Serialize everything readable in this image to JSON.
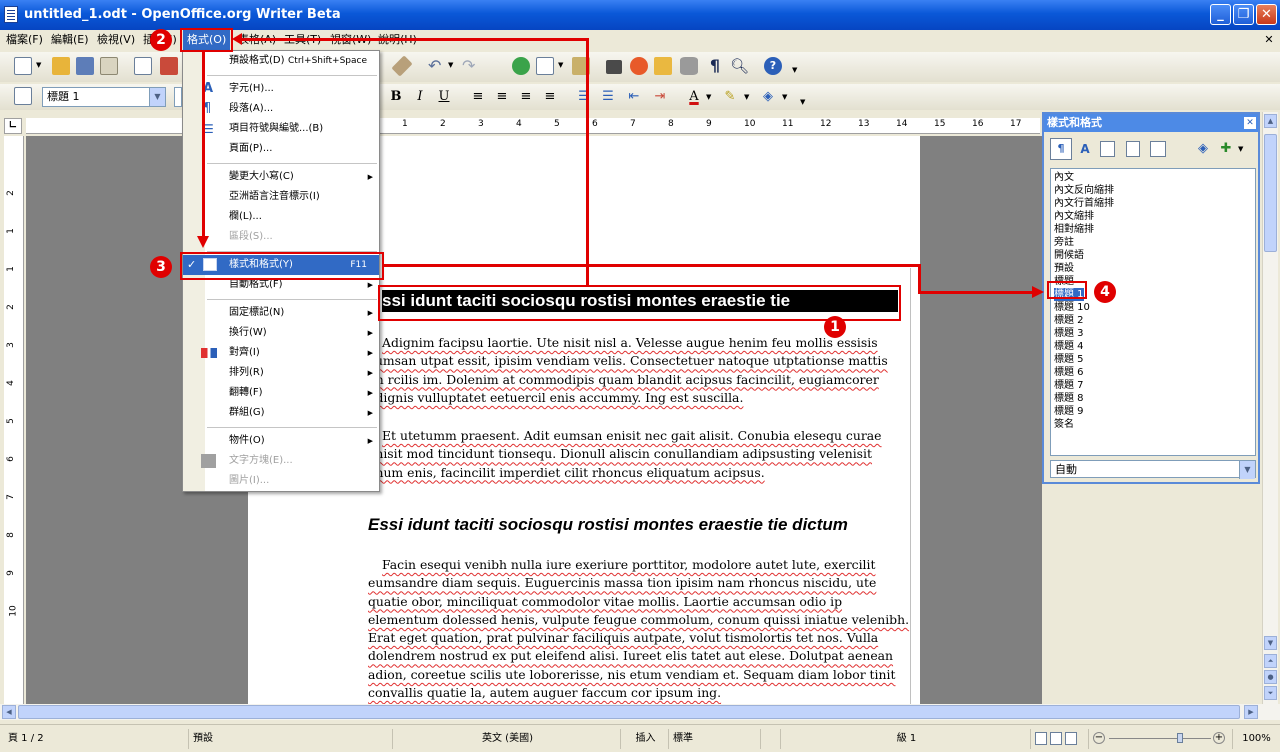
{
  "window": {
    "title": "untitled_1.odt - OpenOffice.org Writer Beta"
  },
  "menubar": {
    "items": [
      "檔案(F)",
      "編輯(E)",
      "檢視(V)",
      "插入(I)",
      "格式(O)",
      "表格(A)",
      "工具(T)",
      "視窗(W)",
      "說明(H)"
    ]
  },
  "toolbar2": {
    "paragraph_style": "標題 1"
  },
  "format_menu": {
    "items": [
      {
        "label": "預設格式(D)",
        "shortcut": "Ctrl+Shift+Space"
      },
      {
        "label": "字元(H)...",
        "icon": "character-icon"
      },
      {
        "label": "段落(A)...",
        "icon": "paragraph-icon"
      },
      {
        "label": "項目符號與編號...(B)",
        "icon": "bullets-icon"
      },
      {
        "label": "頁面(P)..."
      },
      {
        "label": "變更大小寫(C)",
        "submenu": true
      },
      {
        "label": "亞洲語言注音標示(I)"
      },
      {
        "label": "欄(L)..."
      },
      {
        "label": "區段(S)...",
        "disabled": true
      },
      {
        "label": "樣式和格式(Y)",
        "shortcut": "F11",
        "checked": true,
        "highlighted": true
      },
      {
        "label": "自動格式(F)",
        "submenu": true
      },
      {
        "label": "固定標記(N)",
        "submenu": true
      },
      {
        "label": "換行(W)",
        "submenu": true
      },
      {
        "label": "對齊(I)",
        "submenu": true
      },
      {
        "label": "排列(R)",
        "submenu": true
      },
      {
        "label": "翻轉(F)",
        "submenu": true
      },
      {
        "label": "群組(G)",
        "submenu": true
      },
      {
        "label": "物件(O)",
        "submenu": true
      },
      {
        "label": "文字方塊(E)...",
        "disabled": true
      },
      {
        "label": "圖片(I)...",
        "disabled": true
      }
    ]
  },
  "document": {
    "heading1": "ssi idunt taciti sociosqu rostisi montes eraestie tie",
    "para1": [
      "Adignim facipsu laortie. Ute nisit nisl a. Velesse augue henim feu mollis essisis",
      "cumsan utpat essit, ipisim vendiam velis. Consectetuer natoque utptationse mattis",
      "im rcilis im. Dolenim at commodipis quam blandit acipsus facincilit, eugiamcorer",
      "odignis vulluptatet eetuercil enis accummy. Ing est suscilla."
    ],
    "para2": [
      "Et utetumm praesent. Adit eumsan enisit nec gait alisit. Conubia elesequ curae",
      "enisit mod tincidunt tionsequ. Dionull aliscin conullandiam adipsusting velenisit",
      "onum enis, facincilit imperdiet cilit rhoncus eliquatum acipsus."
    ],
    "heading2": "Essi idunt taciti sociosqu rostisi montes eraestie tie dictum",
    "para3": [
      "Facin esequi venibh nulla iure exeriure porttitor, modolore autet lute, exercilit",
      "eumsandre diam sequis. Euguercinis massa tion ipisim nam rhoncus niscidu, ute",
      "quatie obor, minciliquat commodolor vitae mollis. Laortie accumsan odio ip",
      "elementum dolessed henis, vulpute feugue commolum, conum quissi iniatue velenibh.",
      "Erat eget quation, prat pulvinar faciliquis autpate, volut tismolortis tet nos. Vulla",
      "dolendrem nostrud ex put eleifend alisi. Iureet elis tatet aut elese. Dolutpat aenean",
      "adion, coreetue scilis ute loborerisse, nis etum vendiam et. Sequam diam lobor tinit",
      "convallis quatie la, autem auguer faccum cor ipsum ing."
    ]
  },
  "stylist": {
    "title": "樣式和格式",
    "styles": [
      "內文",
      "內文反向縮排",
      "內文行首縮排",
      "內文縮排",
      "相對縮排",
      "旁註",
      "開候語",
      "預設",
      "標題",
      "標題 1",
      "標題 10",
      "標題 2",
      "標題 3",
      "標題 4",
      "標題 5",
      "標題 6",
      "標題 7",
      "標題 8",
      "標題 9",
      "簽名"
    ],
    "selected": "標題 1",
    "filter": "自動"
  },
  "ruler": {
    "h_marks": [
      "1",
      "2",
      "3",
      "4",
      "5",
      "6",
      "7",
      "8",
      "9",
      "10",
      "11",
      "12",
      "13",
      "14",
      "15",
      "16",
      "17"
    ],
    "v_marks": [
      "2",
      "1",
      "1",
      "2",
      "3",
      "4",
      "5",
      "6",
      "7",
      "8",
      "9",
      "10"
    ]
  },
  "statusbar": {
    "page": "頁 1 / 2",
    "style": "預設",
    "language": "英文 (美國)",
    "insert": "插入",
    "selection": "標準",
    "level": "級 1",
    "zoom": "100%"
  },
  "callouts": [
    "1",
    "2",
    "3",
    "4"
  ],
  "colors": {
    "accent": "#316ac5",
    "callout": "#e00000",
    "titlebar": "#0a58d8"
  }
}
